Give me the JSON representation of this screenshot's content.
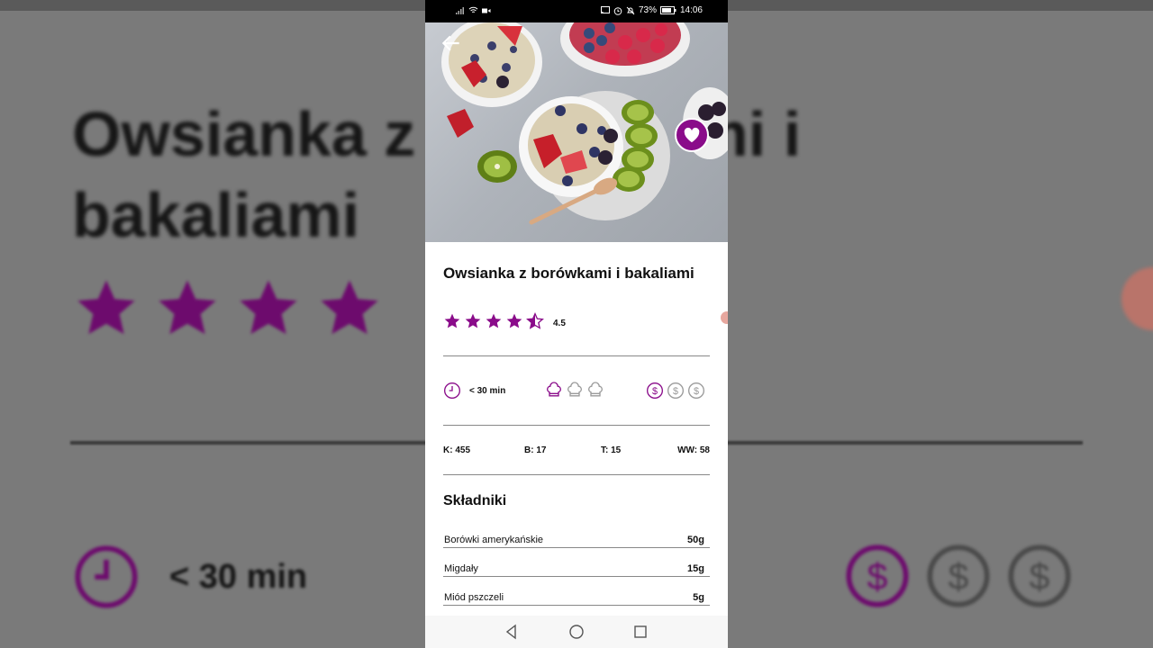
{
  "background": {
    "title": "Owsianka z borówkami i bakaliami",
    "time": "< 30 min"
  },
  "statusbar": {
    "battery": "73%",
    "time": "14:06"
  },
  "recipe": {
    "title": "Owsianka z borówkami i bakaliami",
    "rating": "4.5",
    "rating_value": 4.5,
    "time": "< 30 min",
    "difficulty_level": 1,
    "difficulty_max": 3,
    "cost_level": 1,
    "cost_max": 3
  },
  "macros": {
    "k": "K: 455",
    "b": "B: 17",
    "t": "T: 15",
    "ww": "WW: 58"
  },
  "ingredients_section": {
    "title": "Składniki",
    "items": [
      {
        "name": "Borówki amerykańskie",
        "qty": "50g"
      },
      {
        "name": "Migdały",
        "qty": "15g"
      },
      {
        "name": "Miód pszczeli",
        "qty": "5g"
      }
    ]
  },
  "colors": {
    "accent": "#8a0c8a",
    "inactive_icon": "#9a9a9a"
  },
  "icons": {
    "back": "arrow-left-icon",
    "favorite": "heart-icon",
    "time": "clock-icon",
    "difficulty": "chef-hat-icon",
    "cost": "dollar-coin-icon",
    "nav_back": "triangle-back-icon",
    "nav_home": "circle-home-icon",
    "nav_recents": "square-recents-icon"
  }
}
